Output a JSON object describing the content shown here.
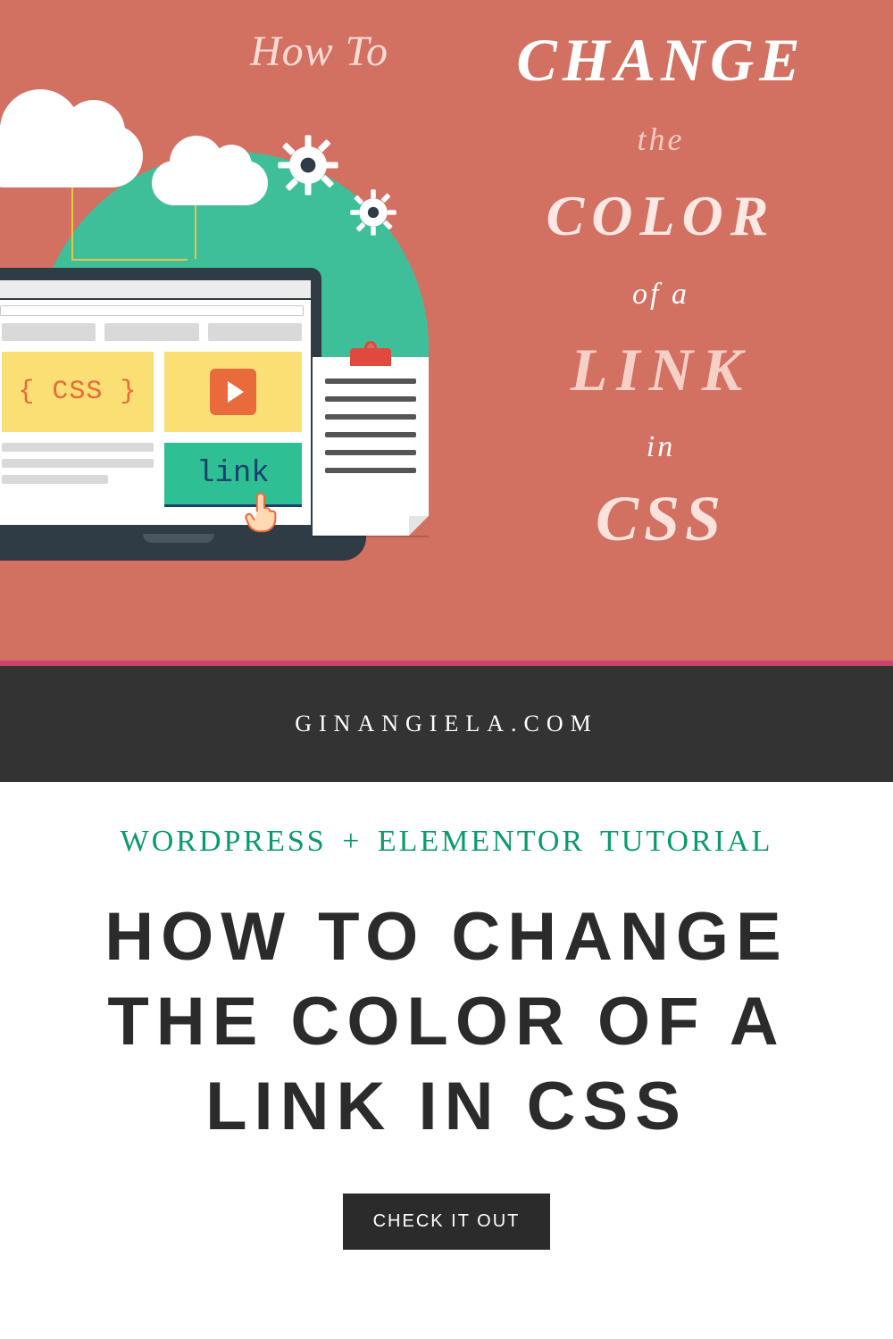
{
  "hero": {
    "howto": "How To",
    "change": "CHANGE",
    "the": "the",
    "color": "COLOR",
    "ofa": "of a",
    "link": "LINK",
    "in": "in",
    "css": "CSS"
  },
  "illustration": {
    "css_label": "{ CSS }",
    "link_label": "link"
  },
  "sitebar": {
    "domain": "GINANGIELA.COM"
  },
  "lower": {
    "subtitle": "WORDPRESS + ELEMENTOR TUTORIAL",
    "title": "HOW TO CHANGE THE COLOR OF A LINK IN CSS",
    "cta": "CHECK IT OUT"
  },
  "colors": {
    "hero_bg": "#d27062",
    "accent_green": "#3fbf99",
    "accent_orange": "#e96a3b",
    "accent_yellow": "#fadf75",
    "text_green": "#0a9a6e",
    "dark": "#2b2b2b",
    "pink_divider": "#c9436a"
  }
}
